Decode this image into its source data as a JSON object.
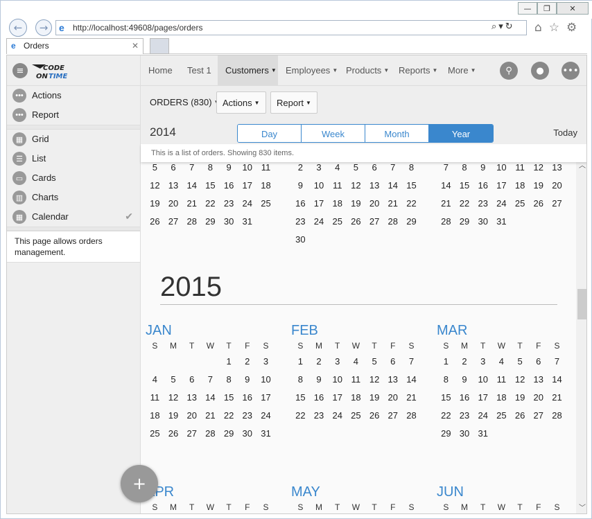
{
  "browser": {
    "url": "http://localhost:49608/pages/orders",
    "tab_title": "Orders"
  },
  "sidebar": {
    "items_top": [
      {
        "label": "Actions",
        "icon": "more-icon"
      },
      {
        "label": "Report",
        "icon": "more-icon"
      }
    ],
    "views": [
      {
        "label": "Grid",
        "icon": "grid-icon"
      },
      {
        "label": "List",
        "icon": "list-icon"
      },
      {
        "label": "Cards",
        "icon": "cards-icon"
      },
      {
        "label": "Charts",
        "icon": "charts-icon"
      },
      {
        "label": "Calendar",
        "icon": "calendar-icon",
        "checked": true
      }
    ],
    "note": "This page allows orders management."
  },
  "topnav": {
    "items": [
      "Home",
      "Test 1",
      "Customers",
      "Employees",
      "Products",
      "Reports",
      "More"
    ],
    "active": "Customers"
  },
  "toolbar": {
    "orders": "ORDERS (830)",
    "actions": "Actions",
    "report": "Report"
  },
  "calendar": {
    "year_label": "2014",
    "modes": [
      "Day",
      "Week",
      "Month",
      "Year"
    ],
    "active_mode": "Year",
    "today": "Today",
    "info": "This is a list of orders. Showing 830 items.",
    "big_year": "2015",
    "weekdays": [
      "S",
      "M",
      "T",
      "W",
      "T",
      "F",
      "S"
    ],
    "partial_months": [
      {
        "rows": [
          [
            "5",
            "6",
            "7",
            "8",
            "9",
            "10",
            "11"
          ],
          [
            "12",
            "13",
            "14",
            "15",
            "16",
            "17",
            "18"
          ],
          [
            "19",
            "20",
            "21",
            "22",
            "23",
            "24",
            "25"
          ],
          [
            "26",
            "27",
            "28",
            "29",
            "30",
            "31",
            ""
          ]
        ]
      },
      {
        "rows": [
          [
            "2",
            "3",
            "4",
            "5",
            "6",
            "7",
            "8"
          ],
          [
            "9",
            "10",
            "11",
            "12",
            "13",
            "14",
            "15"
          ],
          [
            "16",
            "17",
            "18",
            "19",
            "20",
            "21",
            "22"
          ],
          [
            "23",
            "24",
            "25",
            "26",
            "27",
            "28",
            "29"
          ],
          [
            "30",
            "",
            "",
            "",
            "",
            "",
            ""
          ]
        ]
      },
      {
        "rows": [
          [
            "7",
            "8",
            "9",
            "10",
            "11",
            "12",
            "13"
          ],
          [
            "14",
            "15",
            "16",
            "17",
            "18",
            "19",
            "20"
          ],
          [
            "21",
            "22",
            "23",
            "24",
            "25",
            "26",
            "27"
          ],
          [
            "28",
            "29",
            "30",
            "31",
            "",
            "",
            ""
          ]
        ]
      }
    ],
    "months_2015": [
      {
        "name": "JAN",
        "rows": [
          [
            "",
            "",
            "",
            "",
            "1",
            "2",
            "3"
          ],
          [
            "4",
            "5",
            "6",
            "7",
            "8",
            "9",
            "10"
          ],
          [
            "11",
            "12",
            "13",
            "14",
            "15",
            "16",
            "17"
          ],
          [
            "18",
            "19",
            "20",
            "21",
            "22",
            "23",
            "24"
          ],
          [
            "25",
            "26",
            "27",
            "28",
            "29",
            "30",
            "31"
          ]
        ]
      },
      {
        "name": "FEB",
        "rows": [
          [
            "1",
            "2",
            "3",
            "4",
            "5",
            "6",
            "7"
          ],
          [
            "8",
            "9",
            "10",
            "11",
            "12",
            "13",
            "14"
          ],
          [
            "15",
            "16",
            "17",
            "18",
            "19",
            "20",
            "21"
          ],
          [
            "22",
            "23",
            "24",
            "25",
            "26",
            "27",
            "28"
          ]
        ]
      },
      {
        "name": "MAR",
        "rows": [
          [
            "1",
            "2",
            "3",
            "4",
            "5",
            "6",
            "7"
          ],
          [
            "8",
            "9",
            "10",
            "11",
            "12",
            "13",
            "14"
          ],
          [
            "15",
            "16",
            "17",
            "18",
            "19",
            "20",
            "21"
          ],
          [
            "22",
            "23",
            "24",
            "25",
            "26",
            "27",
            "28"
          ],
          [
            "29",
            "30",
            "31",
            "",
            "",
            "",
            ""
          ]
        ]
      }
    ],
    "months_next": [
      "APR",
      "MAY",
      "JUN"
    ]
  }
}
